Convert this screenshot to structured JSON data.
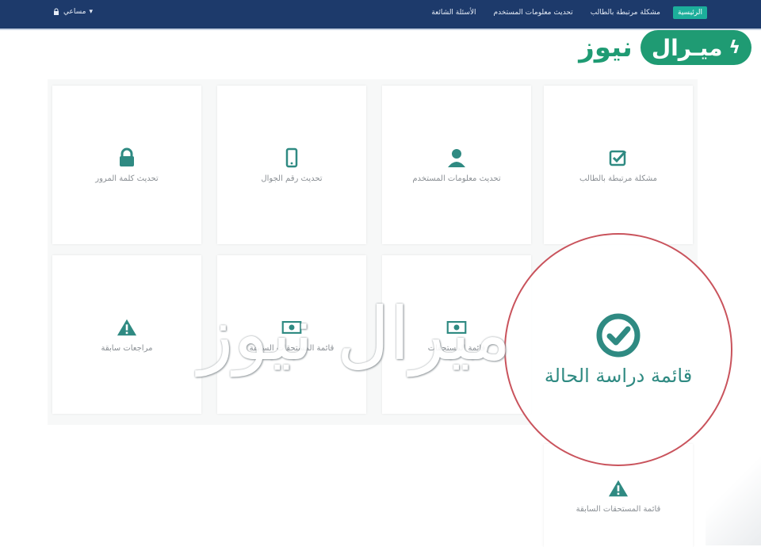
{
  "topbar": {
    "user_label": "مساعي",
    "nav": [
      {
        "label": "الرئيسية",
        "active": true
      },
      {
        "label": "مشكلة مرتبطة بالطالب",
        "active": false
      },
      {
        "label": "تحديث معلومات المستخدم",
        "active": false
      },
      {
        "label": "الأسئلة الشائعة",
        "active": false
      }
    ]
  },
  "logo": {
    "pill_text": "ميـرال",
    "plain_text": "نيوز"
  },
  "cards": [
    {
      "label": "مشكلة مرتبطة بالطالب",
      "icon": "checkbox-icon"
    },
    {
      "label": "تحديث معلومات المستخدم",
      "icon": "user-icon"
    },
    {
      "label": "تحديث رقم الجوال",
      "icon": "mobile-icon"
    },
    {
      "label": "تحديث كلمة المرور",
      "icon": "lock-icon"
    },
    {
      "label": "قائمة المستحقات",
      "icon": "money-icon"
    },
    {
      "label": "قائمة المستحقات السابقة",
      "icon": "money-icon"
    },
    {
      "label": "مراجعات سابقة",
      "icon": "warning-icon"
    },
    {
      "label": "قائمة المستحقات السابقة",
      "icon": "warning-icon"
    }
  ],
  "highlight": {
    "label": "قائمة دراسة الحالة",
    "icon": "check-circle-icon"
  },
  "watermark": "ميرال نيوز",
  "colors": {
    "navbar": "#1d3a6b",
    "accent": "#1cae9b",
    "logo": "#1f9b73",
    "circle": "#c9535c",
    "icon": "#2f8a82"
  }
}
